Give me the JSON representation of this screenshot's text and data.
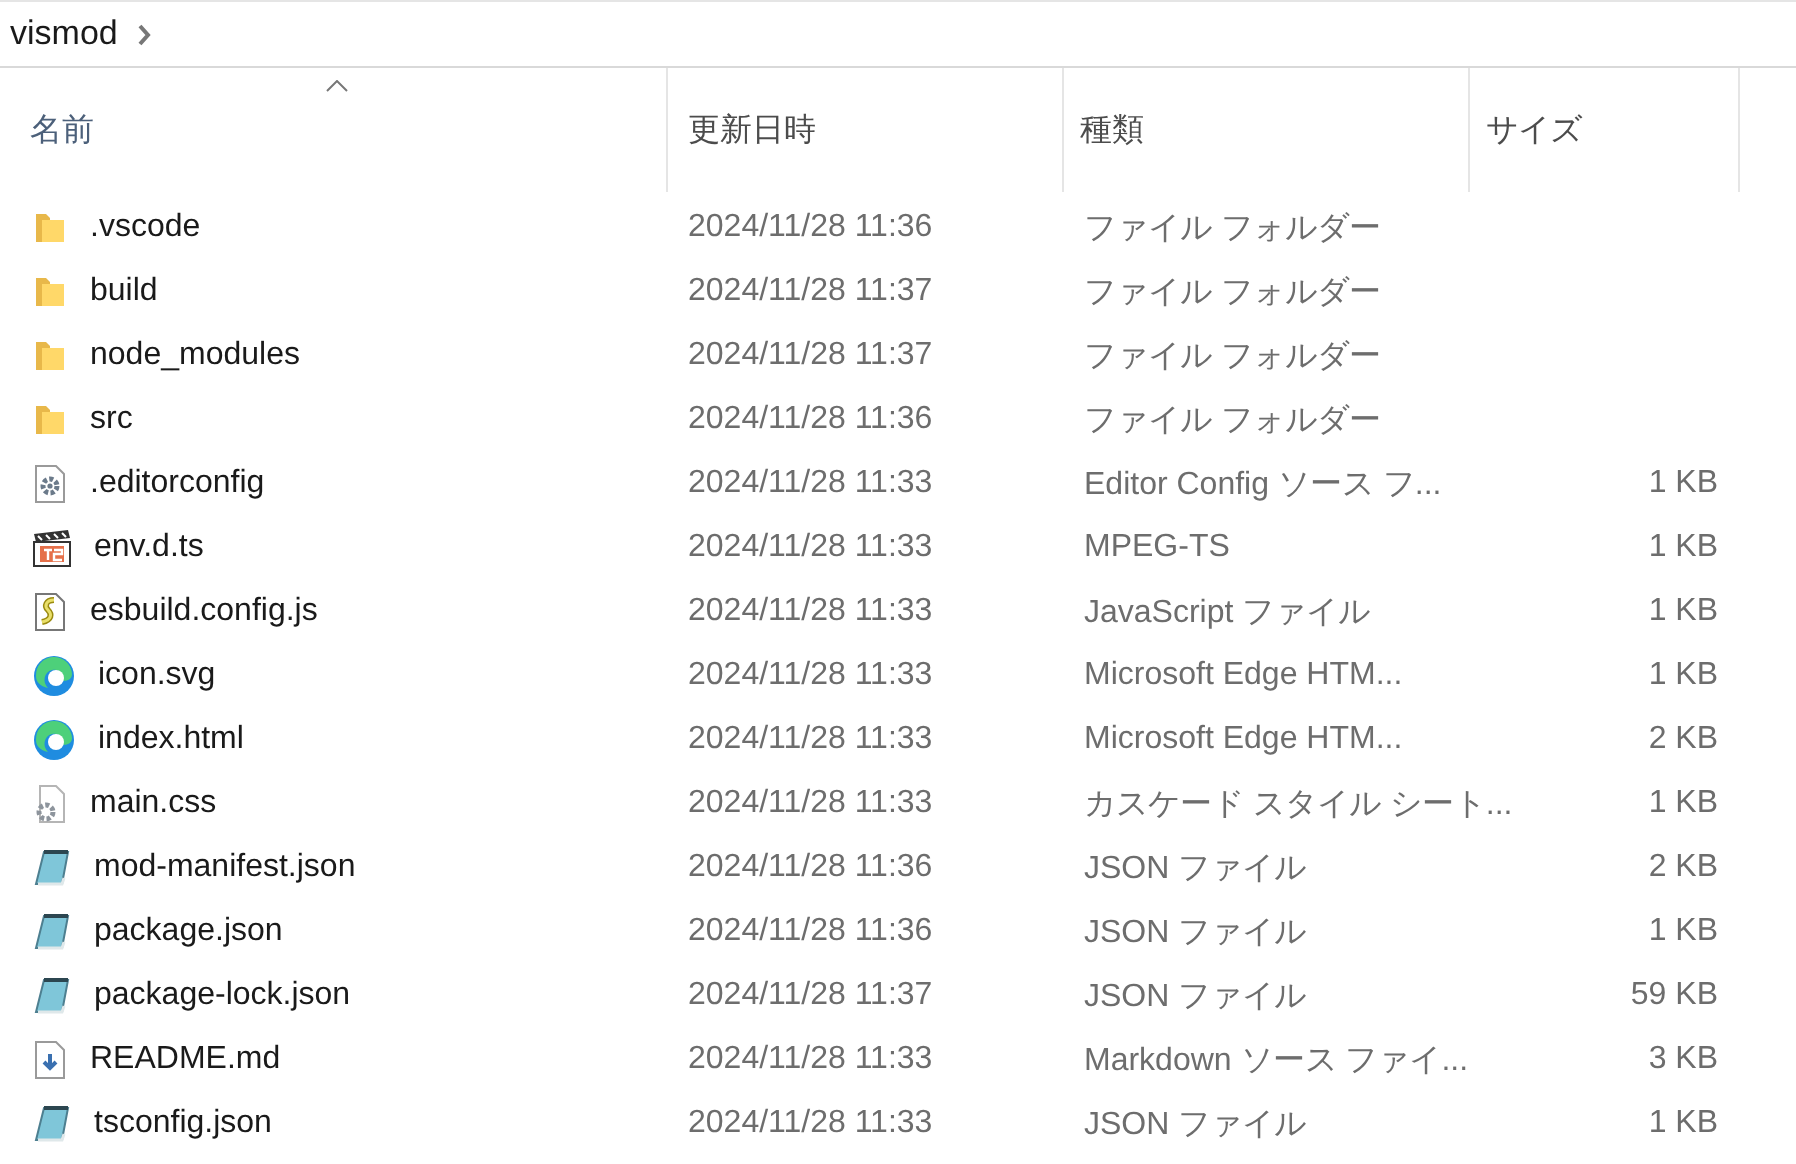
{
  "breadcrumb": {
    "items": [
      {
        "label": "vismod"
      }
    ]
  },
  "columns": [
    {
      "label": "名前",
      "sorted": true
    },
    {
      "label": "更新日時",
      "sorted": false
    },
    {
      "label": "種類",
      "sorted": false
    },
    {
      "label": "サイズ",
      "sorted": false
    }
  ],
  "rows": [
    {
      "kind": "folder",
      "name": ".vscode",
      "modified": "2024/11/28 11:36",
      "type": "ファイル フォルダー"
    },
    {
      "kind": "folder",
      "name": "build",
      "modified": "2024/11/28 11:37",
      "type": "ファイル フォルダー"
    },
    {
      "kind": "folder",
      "name": "node_modules",
      "modified": "2024/11/28 11:37",
      "type": "ファイル フォルダー"
    },
    {
      "kind": "folder",
      "name": "src",
      "modified": "2024/11/28 11:36",
      "type": "ファイル フォルダー"
    },
    {
      "kind": "config",
      "name": ".editorconfig",
      "modified": "2024/11/28 11:33",
      "type": "Editor Config ソース フ...",
      "size": "1 KB"
    },
    {
      "kind": "video",
      "name": "env.d.ts",
      "modified": "2024/11/28 11:33",
      "type": "MPEG-TS",
      "size": "1 KB"
    },
    {
      "kind": "script",
      "name": "esbuild.config.js",
      "modified": "2024/11/28 11:33",
      "type": "JavaScript ファイル",
      "size": "1 KB"
    },
    {
      "kind": "browser",
      "name": "icon.svg",
      "modified": "2024/11/28 11:33",
      "type": "Microsoft Edge HTM...",
      "size": "1 KB"
    },
    {
      "kind": "browser",
      "name": "index.html",
      "modified": "2024/11/28 11:33",
      "type": "Microsoft Edge HTM...",
      "size": "2 KB"
    },
    {
      "kind": "stylesheet",
      "name": "main.css",
      "modified": "2024/11/28 11:33",
      "type": "カスケード スタイル シート...",
      "size": "1 KB"
    },
    {
      "kind": "notepad",
      "name": "mod-manifest.json",
      "modified": "2024/11/28 11:36",
      "type": "JSON ファイル",
      "size": "2 KB"
    },
    {
      "kind": "notepad",
      "name": "package.json",
      "modified": "2024/11/28 11:36",
      "type": "JSON ファイル",
      "size": "1 KB"
    },
    {
      "kind": "notepad",
      "name": "package-lock.json",
      "modified": "2024/11/28 11:37",
      "type": "JSON ファイル",
      "size": "59 KB"
    },
    {
      "kind": "markdown",
      "name": "README.md",
      "modified": "2024/11/28 11:33",
      "type": "Markdown ソース ファイ...",
      "size": "3 KB"
    },
    {
      "kind": "notepad",
      "name": "tsconfig.json",
      "modified": "2024/11/28 11:33",
      "type": "JSON ファイル",
      "size": "1 KB"
    }
  ]
}
